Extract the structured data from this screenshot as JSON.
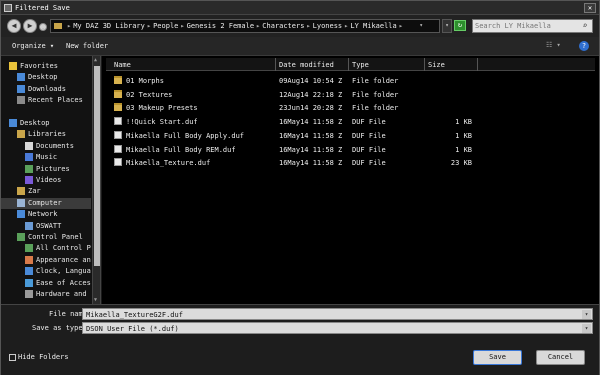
{
  "window": {
    "title": "Filtered Save",
    "close_glyph": "✕"
  },
  "address": {
    "breadcrumb": [
      "My DAZ 3D Library",
      "People",
      "Genesis 2 Female",
      "Characters",
      "Lyoness",
      "LY Mikaella"
    ],
    "search_placeholder": "Search LY Mikaella"
  },
  "toolbar": {
    "organize_label": "Organize",
    "new_folder_label": "New folder",
    "help_glyph": "?"
  },
  "nav": {
    "items": [
      {
        "label": "Favorites",
        "icon": "star-icon",
        "indent": 0
      },
      {
        "label": "Desktop",
        "icon": "desktop-icon",
        "indent": 1
      },
      {
        "label": "Downloads",
        "icon": "downloads-icon",
        "indent": 1
      },
      {
        "label": "Recent Places",
        "icon": "recent-places-icon",
        "indent": 1
      },
      {
        "label": "",
        "icon": "",
        "indent": 0
      },
      {
        "label": "Desktop",
        "icon": "desktop-icon",
        "indent": 0
      },
      {
        "label": "Libraries",
        "icon": "libraries-icon",
        "indent": 1
      },
      {
        "label": "Documents",
        "icon": "documents-icon",
        "indent": 2
      },
      {
        "label": "Music",
        "icon": "music-icon",
        "indent": 2
      },
      {
        "label": "Pictures",
        "icon": "pictures-icon",
        "indent": 2
      },
      {
        "label": "Videos",
        "icon": "videos-icon",
        "indent": 2
      },
      {
        "label": "Zar",
        "icon": "user-icon",
        "indent": 1
      },
      {
        "label": "Computer",
        "icon": "computer-icon",
        "indent": 1,
        "selected": true
      },
      {
        "label": "Network",
        "icon": "network-icon",
        "indent": 1
      },
      {
        "label": "OSWATT",
        "icon": "network-computer-icon",
        "indent": 2
      },
      {
        "label": "Control Panel",
        "icon": "control-panel-icon",
        "indent": 1
      },
      {
        "label": "All Control Par",
        "icon": "control-panel-icon",
        "indent": 2
      },
      {
        "label": "Appearance and",
        "icon": "appearance-icon",
        "indent": 2
      },
      {
        "label": "Clock, Languag",
        "icon": "clock-icon",
        "indent": 2
      },
      {
        "label": "Ease of Access",
        "icon": "ease-of-access-icon",
        "indent": 2
      },
      {
        "label": "Hardware and S",
        "icon": "hardware-icon",
        "indent": 2
      }
    ]
  },
  "files": {
    "columns": [
      "Name",
      "Date modified",
      "Type",
      "Size"
    ],
    "rows": [
      {
        "name": "01 Morphs",
        "date": "09Aug14 10:54 Z",
        "type": "File folder",
        "size": "",
        "kind": "folder"
      },
      {
        "name": "02 Textures",
        "date": "12Aug14 22:18 Z",
        "type": "File folder",
        "size": "",
        "kind": "folder"
      },
      {
        "name": "03 Makeup Presets",
        "date": "23Jun14 20:28 Z",
        "type": "File folder",
        "size": "",
        "kind": "folder"
      },
      {
        "name": "!!Quick Start.duf",
        "date": "16May14 11:58 Z",
        "type": "DUF File",
        "size": "1 KB",
        "kind": "file"
      },
      {
        "name": "Mikaella Full Body Apply.duf",
        "date": "16May14 11:58 Z",
        "type": "DUF File",
        "size": "1 KB",
        "kind": "file"
      },
      {
        "name": "Mikaella Full Body REM.duf",
        "date": "16May14 11:58 Z",
        "type": "DUF File",
        "size": "1 KB",
        "kind": "file"
      },
      {
        "name": "Mikaella_Texture.duf",
        "date": "16May14 11:58 Z",
        "type": "DUF File",
        "size": "23 KB",
        "kind": "file"
      }
    ]
  },
  "bottom": {
    "file_name_label": "File name:",
    "file_name_value": "Mikaella_TextureG2F.duf",
    "save_type_label": "Save as type:",
    "save_type_value": "DSON User File (*.duf)",
    "hide_folders_label": "Hide Folders",
    "save_label": "Save",
    "cancel_label": "Cancel"
  }
}
